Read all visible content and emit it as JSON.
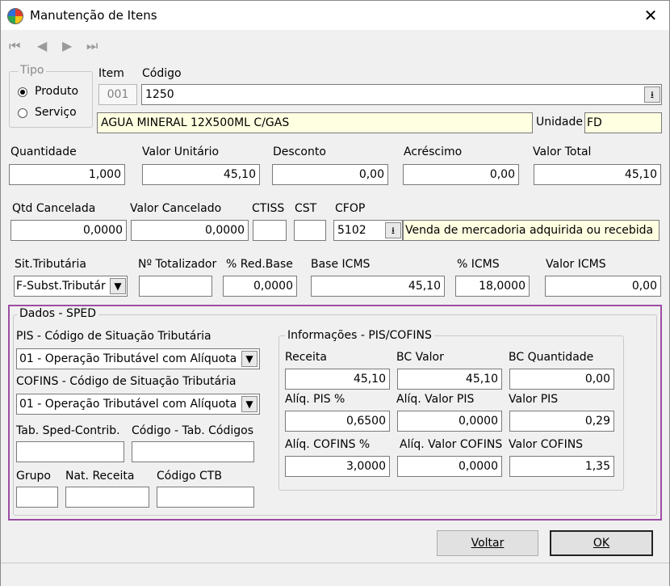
{
  "window": {
    "title": "Manutenção de Itens",
    "close_glyph": "✕"
  },
  "nav": {
    "first": "⏮",
    "prev": "◀",
    "next": "▶",
    "last": "⏭"
  },
  "tipo": {
    "legend": "Tipo",
    "produto": "Produto",
    "servico": "Serviço",
    "selected": "Produto"
  },
  "item": {
    "label": "Item",
    "value": "001"
  },
  "codigo": {
    "label": "Código",
    "value": "1250",
    "description": "AGUA MINERAL  12X500ML C/GAS"
  },
  "unidade": {
    "label": "Unidade",
    "value": "FD"
  },
  "row1": {
    "quantidade": {
      "label": "Quantidade",
      "value": "1,000"
    },
    "valor_unitario": {
      "label": "Valor Unitário",
      "value": "45,10"
    },
    "desconto": {
      "label": "Desconto",
      "value": "0,00"
    },
    "acrescimo": {
      "label": "Acréscimo",
      "value": "0,00"
    },
    "valor_total": {
      "label": "Valor Total",
      "value": "45,10"
    }
  },
  "row2": {
    "qtd_cancelada": {
      "label": "Qtd Cancelada",
      "value": "0,0000"
    },
    "valor_cancelado": {
      "label": "Valor Cancelado",
      "value": "0,0000"
    },
    "ctiss": {
      "label": "CTISS",
      "value": ""
    },
    "cst": {
      "label": "CST",
      "value": ""
    },
    "cfop": {
      "label": "CFOP",
      "value": "5102",
      "description": "Venda de mercadoria adquirida ou recebida"
    }
  },
  "row3": {
    "sit_tributaria": {
      "label": "Sit.Tributária",
      "value": "F-Subst.Tributár"
    },
    "totalizador": {
      "label": "Nº Totalizador",
      "value": ""
    },
    "red_base": {
      "label": "% Red.Base",
      "value": "0,0000"
    },
    "base_icms": {
      "label": "Base ICMS",
      "value": "45,10"
    },
    "pct_icms": {
      "label": "% ICMS",
      "value": "18,0000"
    },
    "valor_icms": {
      "label": "Valor ICMS",
      "value": "0,00"
    }
  },
  "sped": {
    "legend": "Dados - SPED",
    "pis_label": "PIS -  Código de Situação Tributária",
    "pis_value": "01 - Operação Tributável com Alíquota",
    "cofins_label": "COFINS -  Código de Situação Tributária",
    "cofins_value": "01 - Operação Tributável com Alíquota",
    "tab_sped_label": "Tab. Sped-Contrib.",
    "cod_tab_label": "Código - Tab. Códigos",
    "grupo_label": "Grupo",
    "nat_receita_label": "Nat. Receita",
    "codigo_ctb_label": "Código CTB"
  },
  "pis_cofins": {
    "legend": "Informações - PIS/COFINS",
    "receita": {
      "label": "Receita",
      "value": "45,10"
    },
    "bc_valor": {
      "label": "BC Valor",
      "value": "45,10"
    },
    "bc_quantidade": {
      "label": "BC Quantidade",
      "value": "0,00"
    },
    "aliq_pis": {
      "label": "Alíq. PIS %",
      "value": "0,6500"
    },
    "aliq_valor_pis": {
      "label": "Alíq. Valor PIS",
      "value": "0,0000"
    },
    "valor_pis": {
      "label": "Valor PIS",
      "value": "0,29"
    },
    "aliq_cofins": {
      "label": "Alíq. COFINS %",
      "value": "3,0000"
    },
    "aliq_valor_cofins": {
      "label": "Alíq. Valor COFINS",
      "value": "0,0000"
    },
    "valor_cofins": {
      "label": "Valor COFINS",
      "value": "1,35"
    }
  },
  "buttons": {
    "voltar": "Voltar",
    "ok": "OK"
  },
  "colors": {
    "sped_border": "#9b4da3",
    "highlight_field": "#ffffe1"
  }
}
